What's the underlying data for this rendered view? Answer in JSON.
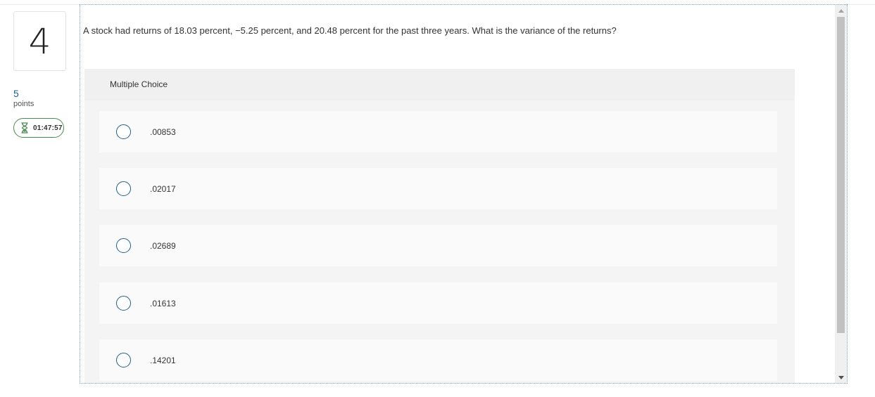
{
  "question_meta": {
    "number": "4",
    "points_value": "5",
    "points_label": "points",
    "timer": "01:47:57",
    "timer_icon": "hourglass-icon"
  },
  "question": {
    "text": "A stock had returns of 18.03 percent, −5.25 percent, and 20.48 percent for the past three years. What is the variance of the returns?",
    "type_label": "Multiple Choice",
    "options": [
      {
        "label": ".00853"
      },
      {
        "label": ".02017"
      },
      {
        "label": ".02689"
      },
      {
        "label": ".01613"
      },
      {
        "label": ".14201"
      }
    ]
  },
  "colors": {
    "accent": "#1f5f8b",
    "timer_border": "#4b8a52",
    "panel_bg": "#f4f4f4",
    "option_bg": "#fafafa"
  }
}
